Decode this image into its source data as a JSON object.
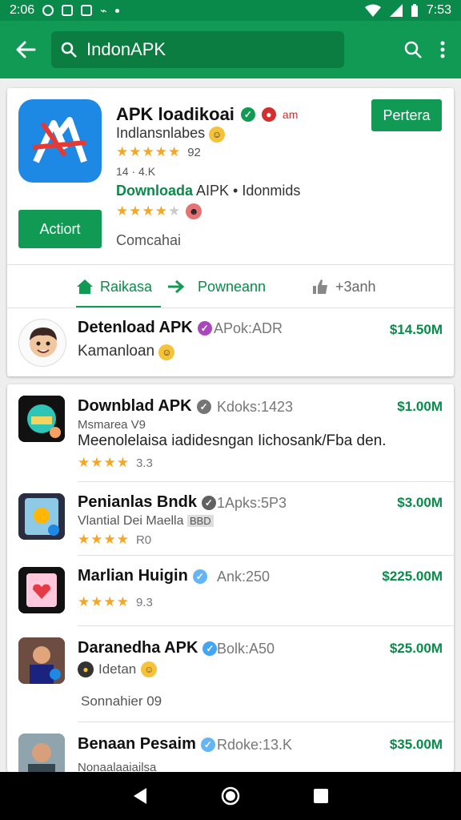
{
  "status": {
    "time_left": "2:06",
    "time_right": "7:53"
  },
  "search": {
    "query": "IndonAPK"
  },
  "featured": {
    "title": "APK loadikoai",
    "badge_text": "am",
    "subtitle": "Indlansnlabes",
    "rating_value": "92",
    "meta": "14 · 4.K",
    "download_green": "Downloada",
    "download_rest": "AIPK • Idonmids",
    "top_button": "Pertera",
    "action_button": "Actiort",
    "comment": "Comcahai",
    "tabs": [
      {
        "label": "Raikasa"
      },
      {
        "label": "Powneann"
      },
      {
        "label": "+3anh"
      }
    ],
    "item": {
      "title": "Detenload APK",
      "code": "APok:ADR",
      "price": "$14.50M",
      "subtitle": "Kamanloan"
    }
  },
  "apps": [
    {
      "title": "Downblad APK",
      "code": "Kdoks:1423",
      "price": "$1.00M",
      "sub": "Msmarea V9",
      "desc": "Meenolelaisa iadidesngan Iichosank/Fba den.",
      "rating": "3.3"
    },
    {
      "title": "Penianlas Bndk",
      "code": "1Apks:5P3",
      "price": "$3.00M",
      "sub": "Vlantial Dei Maella",
      "sub_tag": "BBD",
      "rating": "R0"
    },
    {
      "title": "Marlian Huigin",
      "code": "Ank:250",
      "price": "$225.00M",
      "rating": "9.3"
    },
    {
      "title": "Daranedha APK",
      "code": "Bolk:A50",
      "price": "$25.00M",
      "sub": "Idetan",
      "extra": "Sonnahier 09"
    },
    {
      "title": "Benaan Pesaim",
      "code": "Rdoke:13.K",
      "price": "$35.00M",
      "sub": "Nonaalaaiailsa"
    }
  ],
  "colors": {
    "primary": "#119a54",
    "primary_dark": "#0a8a4a",
    "star": "#f5a623"
  }
}
